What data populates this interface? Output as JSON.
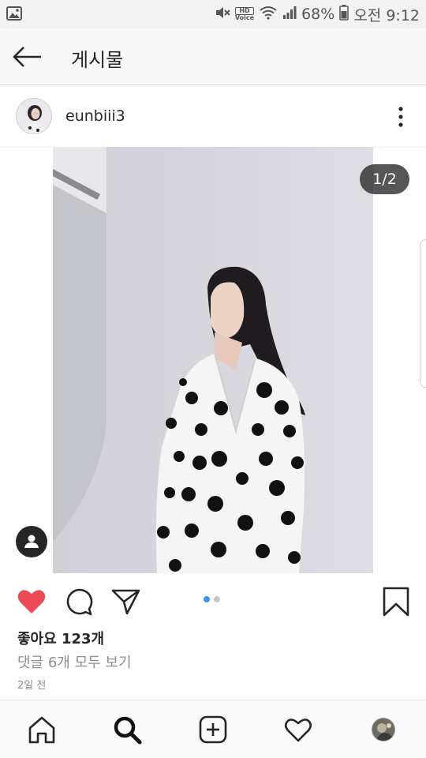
{
  "status_bar": {
    "hd_label": "HD",
    "voice_label": "Voice",
    "battery": "68%",
    "time": "오전 9:12",
    "icons": [
      "image-icon",
      "mute-icon",
      "wifi-icon",
      "signal-icon",
      "battery-icon"
    ]
  },
  "header": {
    "title": "게시물",
    "back_icon": "back-arrow-icon"
  },
  "post": {
    "username": "eunbiii3",
    "page_indicator": "1/2",
    "current_page": 1,
    "total_pages": 2,
    "likes": "좋아요 123개",
    "comments_link": "댓글 6개 모두 보기",
    "timestamp": "2일 전",
    "liked": true
  },
  "actions": {
    "icons": [
      "heart-icon",
      "comment-icon",
      "share-icon",
      "bookmark-icon"
    ]
  },
  "bottom_nav": {
    "items": [
      "home-icon",
      "search-icon",
      "add-post-icon",
      "activity-heart-icon",
      "profile-avatar"
    ]
  },
  "colors": {
    "like_red": "#ed4956",
    "dot_active": "#3897f0",
    "text": "#262626",
    "muted": "#8e8e8e"
  }
}
